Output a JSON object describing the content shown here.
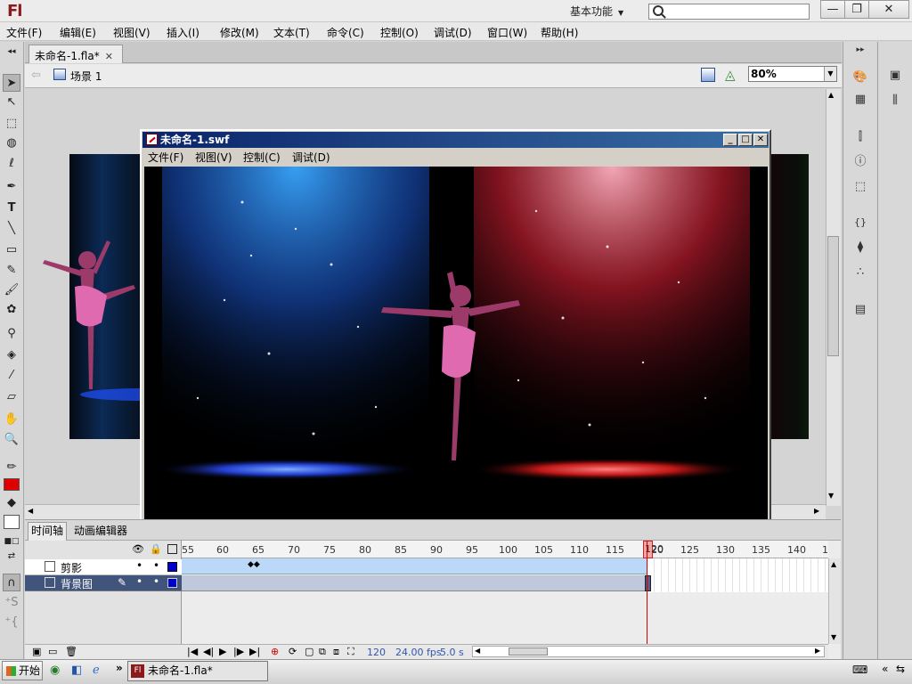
{
  "app": {
    "logo": "Fl",
    "workspace": "基本功能"
  },
  "window_controls": {
    "minimize": "—",
    "maximize": "❐",
    "close": "✕"
  },
  "menu": [
    "文件(F)",
    "编辑(E)",
    "视图(V)",
    "插入(I)",
    "修改(M)",
    "文本(T)",
    "命令(C)",
    "控制(O)",
    "调试(D)",
    "窗口(W)",
    "帮助(H)"
  ],
  "document": {
    "tab_title": "未命名-1.fla*",
    "scene": "场景 1",
    "zoom": "80%"
  },
  "swf_window": {
    "title": "未命名-1.swf",
    "menu": [
      "文件(F)",
      "视图(V)",
      "控制(C)",
      "调试(D)"
    ]
  },
  "timeline": {
    "tabs": [
      "时间轴",
      "动画编辑器"
    ],
    "ruler_ticks": [
      "55",
      "60",
      "65",
      "70",
      "75",
      "80",
      "85",
      "90",
      "95",
      "100",
      "105",
      "110",
      "115",
      "120",
      "125",
      "130",
      "135",
      "140",
      "1"
    ],
    "layers": [
      {
        "name": "剪影",
        "selected": false
      },
      {
        "name": "背景图",
        "selected": true
      }
    ],
    "current_frame": "120",
    "fps": "24.00 fps",
    "time": "5.0 s"
  },
  "taskbar": {
    "start": "开始",
    "task": "未命名-1.fla*"
  },
  "colors": {
    "stroke": "#222222",
    "fill": "#e00000",
    "layer_color": "#0000cc"
  }
}
